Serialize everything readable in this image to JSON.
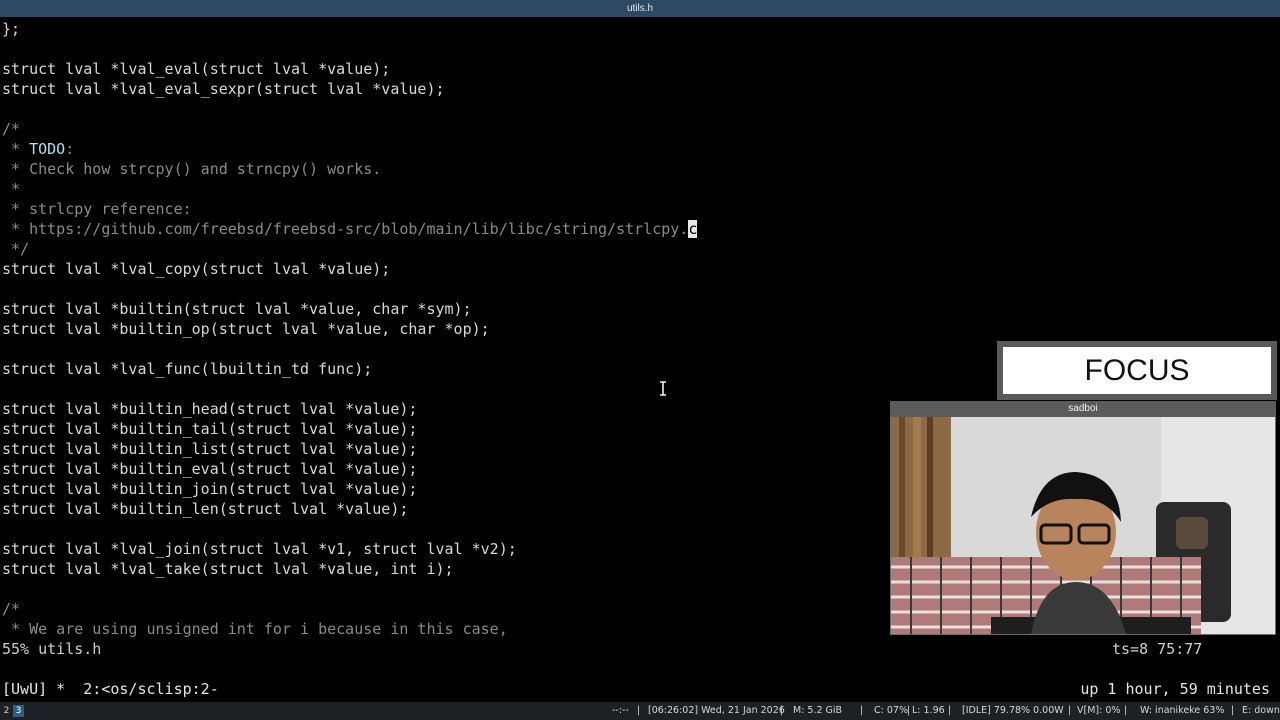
{
  "window": {
    "title": "utils.h"
  },
  "editor": {
    "lines": [
      {
        "text": "};",
        "type": "code"
      },
      {
        "text": "",
        "type": "code"
      },
      {
        "text": "struct lval *lval_eval(struct lval *value);",
        "type": "code"
      },
      {
        "text": "struct lval *lval_eval_sexpr(struct lval *value);",
        "type": "code"
      },
      {
        "text": "",
        "type": "code"
      },
      {
        "text": "/*",
        "type": "comment"
      },
      {
        "text": " * ",
        "type": "comment",
        "todo": "TODO",
        "after": ":"
      },
      {
        "text": " * Check how strcpy() and strncpy() works.",
        "type": "comment"
      },
      {
        "text": " *",
        "type": "comment"
      },
      {
        "text": " * strlcpy reference:",
        "type": "comment"
      },
      {
        "text": " * https://github.com/freebsd/freebsd-src/blob/main/lib/libc/string/strlcpy.",
        "type": "comment",
        "cursor_char": "c"
      },
      {
        "text": " */",
        "type": "comment"
      },
      {
        "text": "struct lval *lval_copy(struct lval *value);",
        "type": "code"
      },
      {
        "text": "",
        "type": "code"
      },
      {
        "text": "struct lval *builtin(struct lval *value, char *sym);",
        "type": "code"
      },
      {
        "text": "struct lval *builtin_op(struct lval *value, char *op);",
        "type": "code"
      },
      {
        "text": "",
        "type": "code"
      },
      {
        "text": "struct lval *lval_func(lbuiltin_td func);",
        "type": "code"
      },
      {
        "text": "",
        "type": "code"
      },
      {
        "text": "struct lval *builtin_head(struct lval *value);",
        "type": "code"
      },
      {
        "text": "struct lval *builtin_tail(struct lval *value);",
        "type": "code"
      },
      {
        "text": "struct lval *builtin_list(struct lval *value);",
        "type": "code"
      },
      {
        "text": "struct lval *builtin_eval(struct lval *value);",
        "type": "code"
      },
      {
        "text": "struct lval *builtin_join(struct lval *value);",
        "type": "code"
      },
      {
        "text": "struct lval *builtin_len(struct lval *value);",
        "type": "code"
      },
      {
        "text": "",
        "type": "code"
      },
      {
        "text": "struct lval *lval_join(struct lval *v1, struct lval *v2);",
        "type": "code"
      },
      {
        "text": "struct lval *lval_take(struct lval *value, int i);",
        "type": "code"
      },
      {
        "text": "",
        "type": "code"
      },
      {
        "text": "/*",
        "type": "comment"
      },
      {
        "text": " * We are using unsigned int for i because in this case,",
        "type": "comment"
      }
    ]
  },
  "modeline": {
    "left": "55% utils.h",
    "right": "ts=8 75:77"
  },
  "tmux": {
    "left": "[UwU] *  2:<os/sclisp:2-",
    "right": "up 1 hour, 59 minutes"
  },
  "statusbar": {
    "workspaces": [
      {
        "label": "2",
        "active": false
      },
      {
        "label": "3",
        "active": true
      }
    ],
    "segments": [
      "--:--",
      "|",
      "[06:26:02] Wed, 21 Jan 2026",
      "|",
      "M: 5.2 GiB",
      "|",
      "C: 07%",
      "|",
      "L: 1.96",
      "|",
      "[IDLE] 79.78% 0.00W",
      "|",
      "V[M]: 0%",
      "|",
      "W: inanikeke 63%",
      "|",
      "E: down"
    ]
  },
  "overlay": {
    "focus_label": "FOCUS"
  },
  "webcam": {
    "title": "sadboi"
  },
  "icons": {
    "text_cursor": "ibeam-cursor-icon"
  },
  "colors": {
    "titlebar": "#2e4a63",
    "comment": "#8a8a8a",
    "todo": "#a9e4f0",
    "active_workspace": "#2b5f86"
  }
}
